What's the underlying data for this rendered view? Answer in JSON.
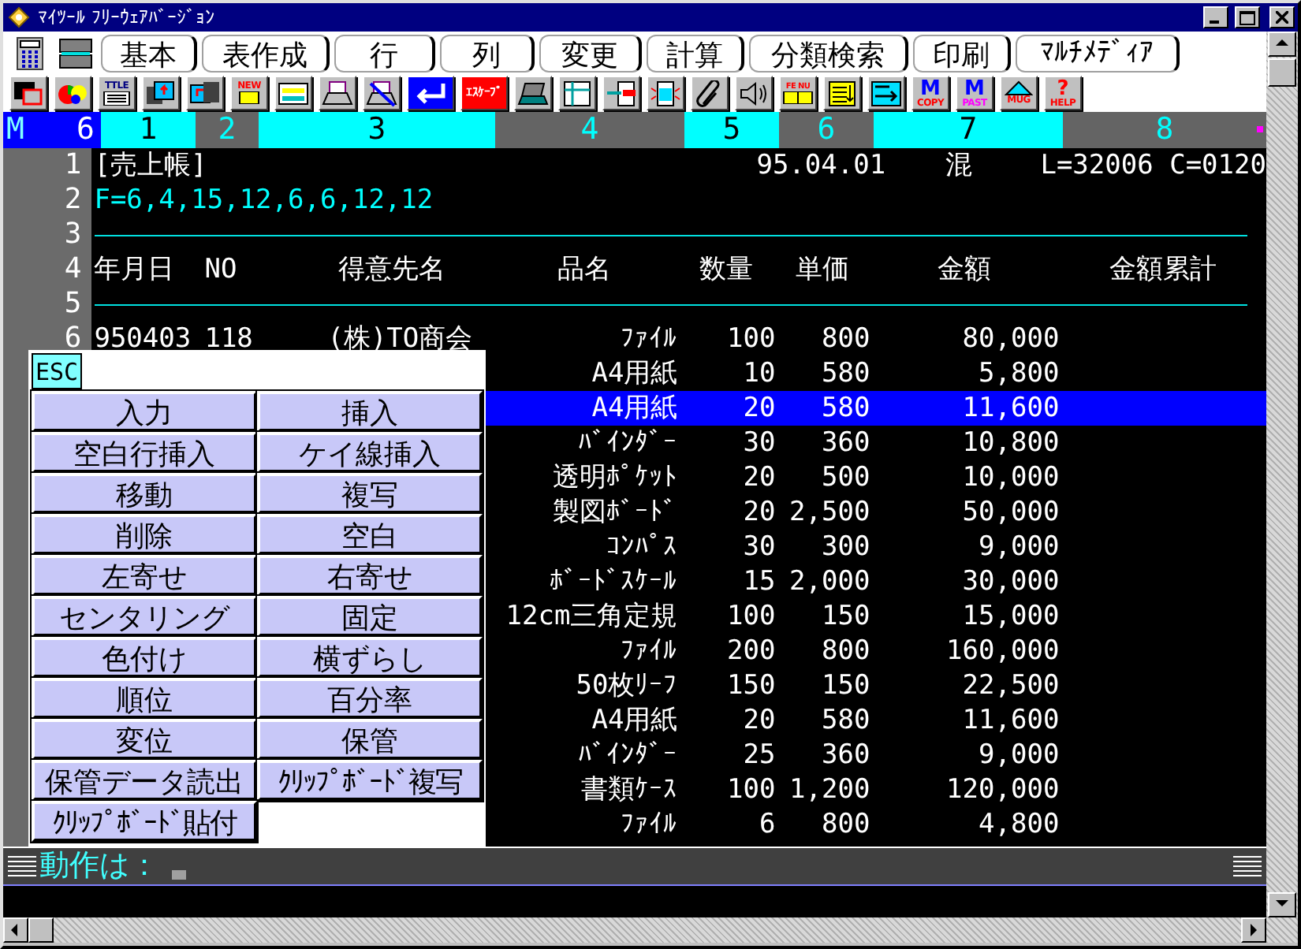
{
  "window": {
    "title": "ﾏｲﾂｰﾙ ﾌﾘｰｳｪｱﾊﾞｰｼﾞｮﾝ"
  },
  "menu": [
    "基本",
    "表作成",
    "行",
    "列",
    "変更",
    "計算",
    "分類検索",
    "印刷",
    "ﾏﾙﾁﾒﾃﾞｨｱ"
  ],
  "toolbar": [
    {
      "kind": "windows"
    },
    {
      "kind": "chart"
    },
    {
      "kind": "doc",
      "label": "TTLE"
    },
    {
      "kind": "save"
    },
    {
      "kind": "load"
    },
    {
      "kind": "new",
      "label": "NEW"
    },
    {
      "kind": "card"
    },
    {
      "kind": "print"
    },
    {
      "kind": "noprint"
    },
    {
      "kind": "enter"
    },
    {
      "kind": "escape",
      "label": "ｴｽｹｰﾌﾟ"
    },
    {
      "kind": "laptop"
    },
    {
      "kind": "table"
    },
    {
      "kind": "import"
    },
    {
      "kind": "sparkdoc"
    },
    {
      "kind": "clip"
    },
    {
      "kind": "speaker"
    },
    {
      "kind": "book",
      "label": "FE NU"
    },
    {
      "kind": "list"
    },
    {
      "kind": "arrowbox"
    },
    {
      "kind": "copy",
      "glyph": "M",
      "label": "COPY"
    },
    {
      "kind": "paste",
      "glyph": "M",
      "label": "PAST"
    },
    {
      "kind": "mug",
      "label": "MUG"
    },
    {
      "kind": "help",
      "glyph": "?",
      "label": "HELP"
    }
  ],
  "ruler": {
    "mode": "M",
    "count": "6",
    "columns": [
      "1",
      "2",
      "3",
      "4",
      "5",
      "6",
      "7",
      "8"
    ]
  },
  "sheet": {
    "rows": [
      {
        "kind": "title",
        "number": "1",
        "name": "[売上帳]",
        "date": "95.04.01",
        "mode": "混",
        "status": "L=32006 C=0120"
      },
      {
        "kind": "format",
        "number": "2",
        "text": "F=6,4,15,12,6,6,12,12"
      },
      {
        "kind": "rule",
        "number": "3"
      },
      {
        "kind": "header",
        "number": "4",
        "columns": [
          "年月日",
          "NO",
          "得意先名",
          "品名",
          "数量",
          "単価",
          "金額",
          "金額累計"
        ]
      },
      {
        "kind": "rule",
        "number": "5"
      },
      {
        "kind": "data",
        "number": "6",
        "selected": false,
        "date": "950403",
        "no": "118",
        "customer": "(株)TO商会",
        "item": "ﾌｧｲﾙ",
        "qty": "100",
        "price": "800",
        "amount": "80,000"
      },
      {
        "kind": "data",
        "selected": false,
        "item": "A4用紙",
        "qty": "10",
        "price": "580",
        "amount": "5,800"
      },
      {
        "kind": "data",
        "selected": true,
        "item": "A4用紙",
        "qty": "20",
        "price": "580",
        "amount": "11,600"
      },
      {
        "kind": "data",
        "selected": false,
        "item": "ﾊﾞｲﾝﾀﾞｰ",
        "qty": "30",
        "price": "360",
        "amount": "10,800"
      },
      {
        "kind": "data",
        "selected": false,
        "item": "透明ﾎﾟｹｯﾄ",
        "qty": "20",
        "price": "500",
        "amount": "10,000"
      },
      {
        "kind": "data",
        "selected": false,
        "item": "製図ﾎﾞｰﾄﾞ",
        "qty": "20",
        "price": "2,500",
        "amount": "50,000"
      },
      {
        "kind": "data",
        "selected": false,
        "item": "ｺﾝﾊﾟｽ",
        "qty": "30",
        "price": "300",
        "amount": "9,000"
      },
      {
        "kind": "data",
        "selected": false,
        "item": "ﾎﾞｰﾄﾞｽｹｰﾙ",
        "qty": "15",
        "price": "2,000",
        "amount": "30,000"
      },
      {
        "kind": "data",
        "selected": false,
        "item": "12cm三角定規",
        "qty": "100",
        "price": "150",
        "amount": "15,000"
      },
      {
        "kind": "data",
        "selected": false,
        "item": "ﾌｧｲﾙ",
        "qty": "200",
        "price": "800",
        "amount": "160,000"
      },
      {
        "kind": "data",
        "selected": false,
        "item": "50枚ﾘｰﾌ",
        "qty": "150",
        "price": "150",
        "amount": "22,500"
      },
      {
        "kind": "data",
        "selected": false,
        "item": "A4用紙",
        "qty": "20",
        "price": "580",
        "amount": "11,600"
      },
      {
        "kind": "data",
        "selected": false,
        "item": "ﾊﾞｲﾝﾀﾞｰ",
        "qty": "25",
        "price": "360",
        "amount": "9,000"
      },
      {
        "kind": "data",
        "selected": false,
        "item": "書類ｹｰｽ",
        "qty": "100",
        "price": "1,200",
        "amount": "120,000"
      },
      {
        "kind": "data",
        "selected": false,
        "item": "ﾌｧｲﾙ",
        "qty": "6",
        "price": "800",
        "amount": "4,800"
      }
    ]
  },
  "popup": {
    "escape": "ESC",
    "actions": [
      "入力",
      "挿入",
      "空白行挿入",
      "ケイ線挿入",
      "移動",
      "複写",
      "削除",
      "空白",
      "左寄せ",
      "右寄せ",
      "センタリング",
      "固定",
      "色付け",
      "横ずらし",
      "順位",
      "百分率",
      "変位",
      "保管",
      "保管データ読出",
      "ｸﾘｯﾌﾟﾎﾞｰﾄﾞ複写",
      "ｸﾘｯﾌﾟﾎﾞｰﾄﾞ貼付"
    ]
  },
  "command": {
    "prompt": "動作は："
  }
}
